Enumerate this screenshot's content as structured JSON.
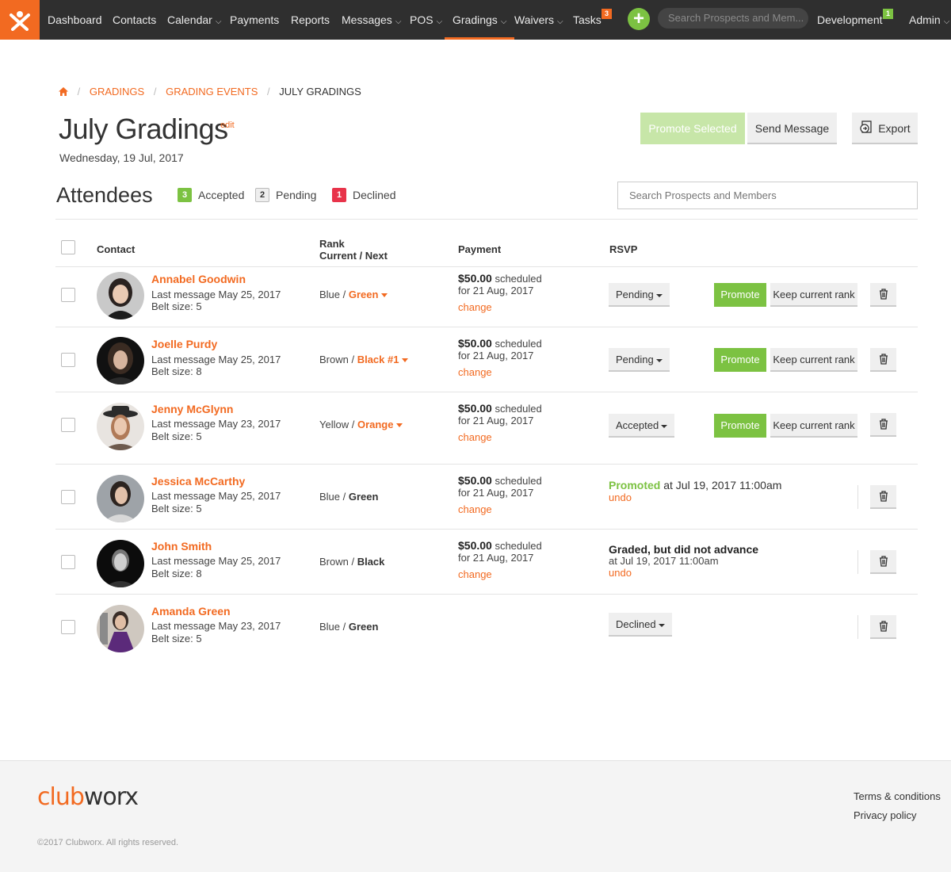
{
  "nav": {
    "items": [
      {
        "label": "Dashboard"
      },
      {
        "label": "Contacts"
      },
      {
        "label": "Calendar"
      },
      {
        "label": "Payments"
      },
      {
        "label": "Reports"
      },
      {
        "label": "Messages"
      },
      {
        "label": "POS"
      },
      {
        "label": "Gradings"
      },
      {
        "label": "Waivers"
      },
      {
        "label": "Tasks"
      }
    ],
    "tasks_badge": "3",
    "search_placeholder": "Search Prospects and Mem...",
    "development_label": "Development",
    "development_badge": "1",
    "admin_label": "Admin",
    "add_symbol": "+",
    "colors": {
      "brand": "#f26a21",
      "green": "#7cc242",
      "bar": "#2f2f2f"
    }
  },
  "breadcrumb": {
    "items": [
      "GRADINGS",
      "GRADING EVENTS"
    ],
    "current": "JULY GRADINGS",
    "separator": "/"
  },
  "page": {
    "title": "July Gradings",
    "edit": "edit",
    "date": "Wednesday, 19 Jul, 2017"
  },
  "actions": {
    "promote_selected": "Promote Selected",
    "send_message": "Send Message",
    "export": "Export"
  },
  "attendees": {
    "title": "Attendees",
    "accepted_count": "3",
    "accepted_label": "Accepted",
    "pending_count": "2",
    "pending_label": "Pending",
    "declined_count": "1",
    "declined_label": "Declined",
    "search_placeholder": "Search Prospects and Members"
  },
  "table": {
    "headers": {
      "contact": "Contact",
      "rank_line1": "Rank",
      "rank_line2": "Current / Next",
      "payment": "Payment",
      "rsvp": "RSVP"
    },
    "rows": [
      {
        "name": "Annabel Goodwin",
        "last_message": "Last message May 25, 2017",
        "belt": "Belt size: 5",
        "rank_current": "Blue /",
        "rank_next": "Green",
        "amount": "$50.00",
        "scheduled": "scheduled",
        "for_date": "for 21 Aug, 2017",
        "change": "change",
        "rsvp": "Pending",
        "promote": "Promote",
        "keep": "Keep current rank"
      },
      {
        "name": "Joelle Purdy",
        "last_message": "Last message May 25, 2017",
        "belt": "Belt size: 8",
        "rank_current": "Brown /",
        "rank_next": "Black #1",
        "amount": "$50.00",
        "scheduled": "scheduled",
        "for_date": "for 21 Aug, 2017",
        "change": "change",
        "rsvp": "Pending",
        "promote": "Promote",
        "keep": "Keep current rank"
      },
      {
        "name": "Jenny McGlynn",
        "last_message": "Last message May 23, 2017",
        "belt": "Belt size: 5",
        "rank_current": "Yellow /",
        "rank_next": "Orange",
        "amount": "$50.00",
        "scheduled": "scheduled",
        "for_date": "for 21 Aug, 2017",
        "change": "change",
        "rsvp": "Accepted",
        "promote": "Promote",
        "keep": "Keep current rank"
      },
      {
        "name": "Jessica McCarthy",
        "last_message": "Last message May 25, 2017",
        "belt": "Belt size: 5",
        "rank_current": "Blue /",
        "rank_next": "Green",
        "amount": "$50.00",
        "scheduled": "scheduled",
        "for_date": "for 21 Aug, 2017",
        "change": "change",
        "status_strong": "Promoted",
        "status_rest": "at Jul 19, 2017 11:00am",
        "undo": "undo"
      },
      {
        "name": "John Smith",
        "last_message": "Last message May 25, 2017",
        "belt": "Belt size: 8",
        "rank_current": "Brown /",
        "rank_next": "Black",
        "amount": "$50.00",
        "scheduled": "scheduled",
        "for_date": "for 21 Aug, 2017",
        "change": "change",
        "status_strong": "Graded, but did not advance",
        "status_rest": "at Jul 19, 2017 11:00am",
        "undo": "undo"
      },
      {
        "name": "Amanda Green",
        "last_message": "Last message May 23, 2017",
        "belt": "Belt size: 5",
        "rank_current": "Blue /",
        "rank_next": "Green",
        "rsvp": "Declined"
      }
    ]
  },
  "footer": {
    "logo_club": "club",
    "logo_worx": "worx",
    "copyright": "©2017 Clubworx. All rights reserved.",
    "terms": "Terms & conditions",
    "privacy": "Privacy policy"
  }
}
